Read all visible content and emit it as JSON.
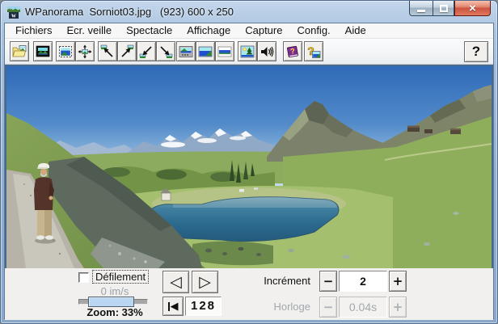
{
  "window": {
    "title": "WPanorama  Sorniot03.jpg   (923) 600 x 250",
    "controls": {
      "minimize": "minimize",
      "maximize": "maximize",
      "close": "close",
      "close_glyph": "×"
    }
  },
  "menu": {
    "items": [
      "Fichiers",
      "Ecr. veille",
      "Spectacle",
      "Affichage",
      "Capture",
      "Config.",
      "Aide"
    ]
  },
  "toolbar": {
    "icons": [
      "open-file",
      "screensaver-preview",
      "copy-image",
      "pan-image",
      "scroll-to-upper-left",
      "scroll-to-upper-right",
      "scroll-to-lower-left",
      "scroll-to-lower-right",
      "panorama-window",
      "full-image",
      "image-strip",
      "slideshow",
      "sound",
      "help-book",
      "about"
    ],
    "help_label": "?"
  },
  "viewer": {
    "description": "Alpine panorama photo: dark blue mountain lake in a green bowl, snowy range and rocky peaks on the horizon, scree slope and gravel footpath with a hiker at left"
  },
  "controls": {
    "defilement": {
      "label": "Défilement",
      "checked": false,
      "speed": "0 im/s",
      "zoom_label": "Zoom: 33%"
    },
    "nav": {
      "prev_glyph": "◁",
      "next_glyph": "▷",
      "first_glyph": "◀",
      "frame": "128"
    },
    "increment": {
      "label": "Incrément",
      "minus": "−",
      "value": "2",
      "plus": "+"
    },
    "horloge": {
      "label": "Horloge",
      "minus": "−",
      "value": "0.04s",
      "plus": "+",
      "enabled": false
    }
  }
}
